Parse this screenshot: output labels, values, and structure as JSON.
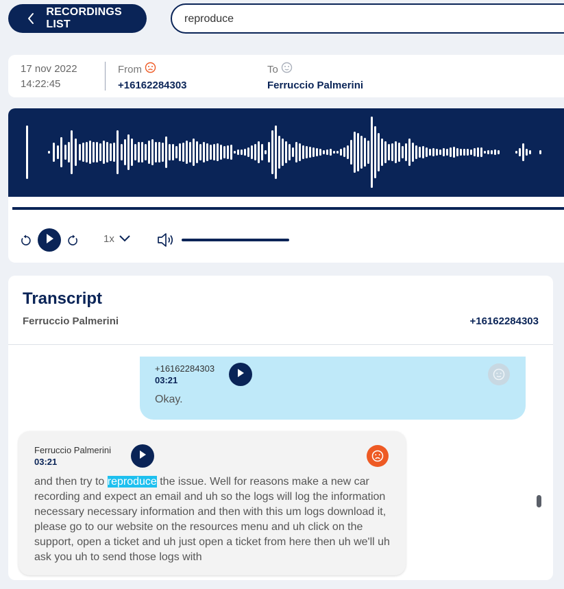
{
  "header": {
    "back_label": "RECORDINGS LIST",
    "search_value": "reproduce"
  },
  "call": {
    "date": "17 nov 2022",
    "time": "14:22:45",
    "from_label": "From",
    "from_value": "+16162284303",
    "to_label": "To",
    "to_value": "Ferruccio Palmerini"
  },
  "player": {
    "speed": "1x",
    "progress": 1.0,
    "volume": 1.0
  },
  "transcript": {
    "title": "Transcript",
    "agent": "Ferruccio Palmerini",
    "caller": "+16162284303",
    "messages": [
      {
        "speaker": "+16162284303",
        "time": "03:21",
        "text": "Okay.",
        "sentiment": "neutral"
      },
      {
        "speaker": "Ferruccio Palmerini",
        "time": "03:21",
        "text_before": "and then try to ",
        "highlight": "reproduce",
        "text_after": " the issue. Well for reasons make a new car recording and expect an email and uh so the logs will log the information necessary necessary information and then with this um logs download it, please go to our website on the resources menu and uh click on the support, open a ticket and uh just open a ticket from here then uh we'll uh ask you uh to send those logs with",
        "sentiment": "negative"
      }
    ]
  },
  "colors": {
    "navy": "#0a2457",
    "highlight": "#1ec0ef",
    "negative": "#ee5a24",
    "caller_bubble": "#bfe9f9",
    "agent_bubble": "#f3f3f3"
  },
  "icons": [
    "chevron-left-icon",
    "frown-icon",
    "neutral-face-icon",
    "replay-icon",
    "play-icon",
    "forward-icon",
    "chevron-down-icon",
    "volume-icon"
  ]
}
